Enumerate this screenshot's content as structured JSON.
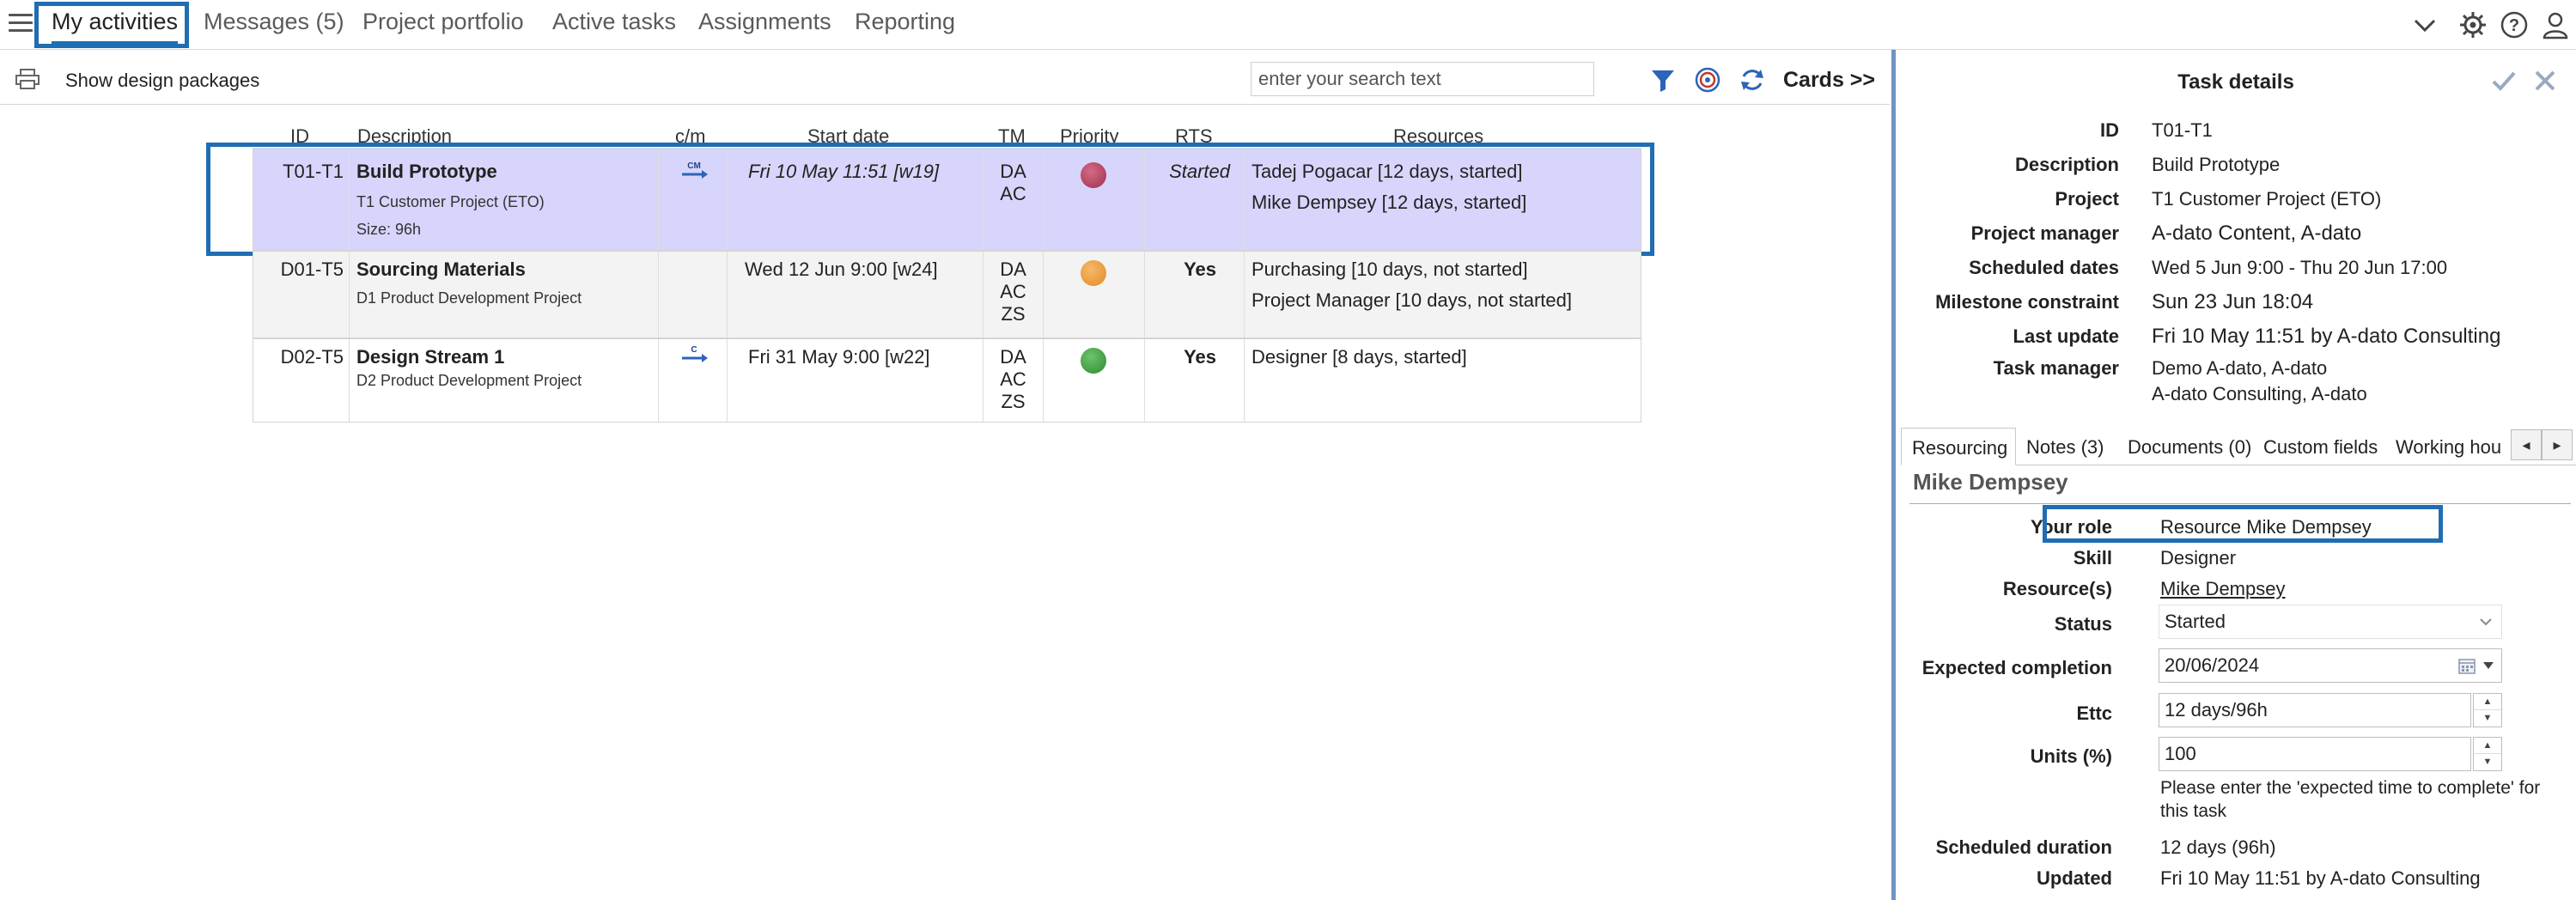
{
  "nav": {
    "tabs": [
      {
        "label": "My activities"
      },
      {
        "label": "Messages (5)"
      },
      {
        "label": "Project portfolio"
      },
      {
        "label": "Active tasks"
      },
      {
        "label": "Assignments"
      },
      {
        "label": "Reporting"
      }
    ],
    "icons": [
      "chevron-down-icon",
      "gear-icon",
      "help-icon",
      "user-icon"
    ]
  },
  "toolbar": {
    "show_design_label": "Show design packages",
    "search_placeholder": "enter your search text",
    "cards_label": "Cards >>"
  },
  "table": {
    "columns": [
      "ID",
      "Description",
      "c/m",
      "Start date",
      "TM",
      "Priority",
      "RTS",
      "Resources"
    ],
    "rows": [
      {
        "id": "T01-T1",
        "title": "Build Prototype",
        "project": "T1 Customer Project (ETO)",
        "size": "Size: 96h",
        "cm": "CM",
        "start": "Fri 10 May 11:51 [w19]",
        "tm": [
          "DA",
          "AC"
        ],
        "priority_color": "#b0415e",
        "rts": "Started",
        "resources": [
          "Tadej Pogacar [12 days, started]",
          "Mike Dempsey [12 days, started]"
        ]
      },
      {
        "id": "D01-T5",
        "title": "Sourcing Materials",
        "project": "D1 Product Development Project",
        "cm": "",
        "start": "Wed 12 Jun 9:00 [w24]",
        "tm": [
          "DA",
          "AC",
          "ZS"
        ],
        "priority_color": "#ee9933",
        "rts": "Yes",
        "resources": [
          "Purchasing [10 days, not started]",
          "Project Manager [10 days, not started]"
        ]
      },
      {
        "id": "D02-T5",
        "title": "Design Stream 1",
        "project": "D2 Product Development Project",
        "cm": "C",
        "start": "Fri 31 May 9:00 [w22]",
        "tm": [
          "DA",
          "AC",
          "ZS"
        ],
        "priority_color": "#3d9a3d",
        "rts": "Yes",
        "resources": [
          "Designer [8 days, started]"
        ]
      }
    ]
  },
  "task_details": {
    "title": "Task details",
    "fields": {
      "id": {
        "label": "ID",
        "value": "T01-T1"
      },
      "description": {
        "label": "Description",
        "value": "Build Prototype"
      },
      "project": {
        "label": "Project",
        "value": "T1 Customer Project (ETO)"
      },
      "project_manager": {
        "label": "Project manager",
        "value": "A-dato Content, A-dato"
      },
      "scheduled_dates": {
        "label": "Scheduled dates",
        "value": "Wed 5 Jun 9:00 - Thu 20 Jun 17:00"
      },
      "milestone_constraint": {
        "label": "Milestone constraint",
        "value": "Sun 23 Jun 18:04"
      },
      "last_update": {
        "label": "Last update",
        "value": "Fri 10 May 11:51 by A-dato Consulting"
      },
      "task_manager": {
        "label": "Task manager",
        "value1": "Demo A-dato, A-dato",
        "value2": "A-dato Consulting, A-dato"
      }
    },
    "tabs": [
      {
        "label": "Resourcing"
      },
      {
        "label": "Notes (3)"
      },
      {
        "label": "Documents (0)"
      },
      {
        "label": "Custom fields"
      },
      {
        "label": "Working hou"
      }
    ],
    "resourcing": {
      "name": "Mike Dempsey",
      "your_role": {
        "label": "Your role",
        "value": "Resource Mike Dempsey"
      },
      "skill": {
        "label": "Skill",
        "value": "Designer"
      },
      "resources": {
        "label": "Resource(s)",
        "value": "Mike Dempsey"
      },
      "status": {
        "label": "Status",
        "value": "Started"
      },
      "expected_completion": {
        "label": "Expected completion",
        "value": "20/06/2024"
      },
      "ettc": {
        "label": "Ettc",
        "value": "12 days/96h"
      },
      "units": {
        "label": "Units (%)",
        "value": "100"
      },
      "hint": "Please enter the 'expected time to complete' for this task",
      "scheduled_duration": {
        "label": "Scheduled duration",
        "value": "12 days (96h)"
      },
      "updated": {
        "label": "Updated",
        "value": "Fri 10 May 11:51 by A-dato Consulting"
      }
    }
  },
  "colors": {
    "accent": "#1f6db2",
    "selected_row": "#d7d5fb",
    "alt_row": "#f3f3f3",
    "yes_green": "#1e8a1e"
  }
}
